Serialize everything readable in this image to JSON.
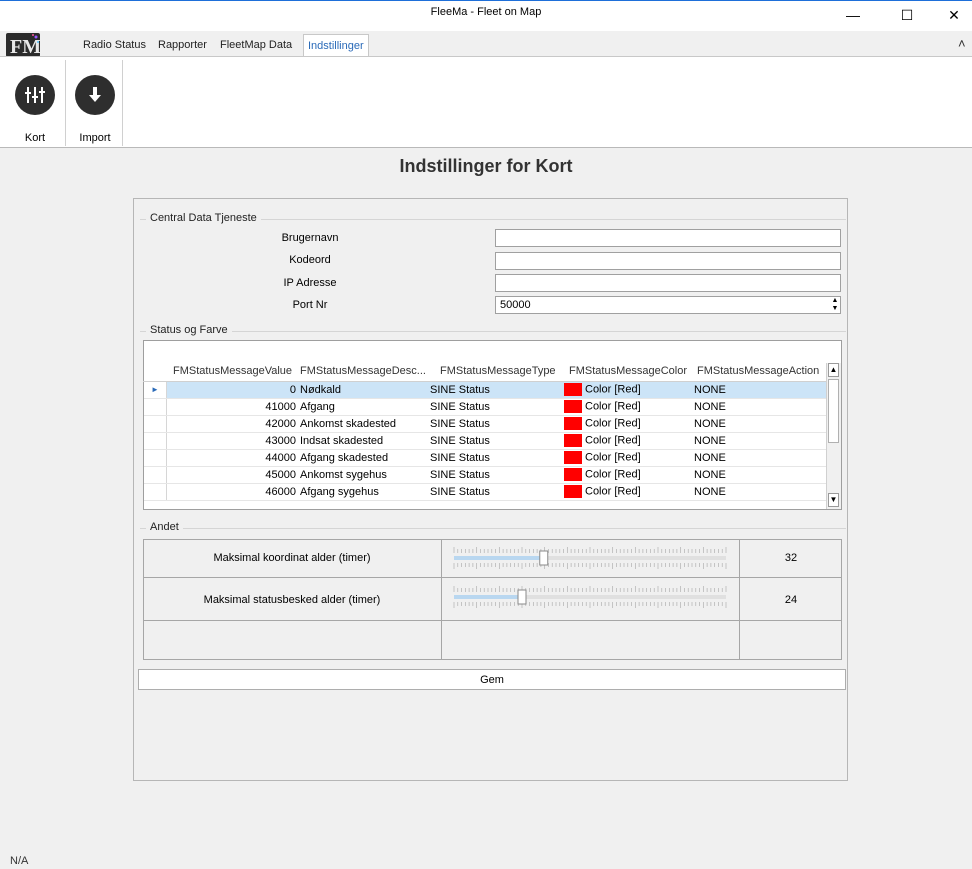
{
  "window": {
    "title": "FleeMa - Fleet on Map",
    "minimize": "—",
    "maximize": "☐",
    "close": "✕"
  },
  "logo_text": "FM",
  "ribbon": {
    "tabs": [
      "Radio Status",
      "Rapporter",
      "FleetMap Data",
      "Indstillinger"
    ],
    "active_tab": "Indstillinger",
    "collapse_glyph": "˄",
    "buttons": [
      {
        "label": "Kort",
        "icon": "sliders-icon"
      },
      {
        "label": "Import",
        "icon": "download-arrow-icon"
      }
    ]
  },
  "page_title": "Indstillinger for Kort",
  "central": {
    "group_label": "Central Data Tjeneste",
    "fields": [
      {
        "label": "Brugernavn",
        "value": ""
      },
      {
        "label": "Kodeord",
        "value": ""
      },
      {
        "label": "IP Adresse",
        "value": ""
      },
      {
        "label": "Port Nr",
        "value": "50000"
      }
    ]
  },
  "status": {
    "group_label": "Status og Farve",
    "columns": [
      "FMStatusMessageValue",
      "FMStatusMessageDesc...",
      "FMStatusMessageType",
      "FMStatusMessageColor",
      "FMStatusMessageAction"
    ],
    "rows": [
      {
        "value": "0",
        "desc": "Nødkald",
        "type": "SINE Status",
        "color_name": "Color [Red]",
        "color": "#ff0000",
        "action": "NONE"
      },
      {
        "value": "41000",
        "desc": "Afgang",
        "type": "SINE Status",
        "color_name": "Color [Red]",
        "color": "#ff0000",
        "action": "NONE"
      },
      {
        "value": "42000",
        "desc": "Ankomst skadested",
        "type": "SINE Status",
        "color_name": "Color [Red]",
        "color": "#ff0000",
        "action": "NONE"
      },
      {
        "value": "43000",
        "desc": "Indsat skadested",
        "type": "SINE Status",
        "color_name": "Color [Red]",
        "color": "#ff0000",
        "action": "NONE"
      },
      {
        "value": "44000",
        "desc": "Afgang skadested",
        "type": "SINE Status",
        "color_name": "Color [Red]",
        "color": "#ff0000",
        "action": "NONE"
      },
      {
        "value": "45000",
        "desc": "Ankomst sygehus",
        "type": "SINE Status",
        "color_name": "Color [Red]",
        "color": "#ff0000",
        "action": "NONE"
      },
      {
        "value": "46000",
        "desc": "Afgang sygehus",
        "type": "SINE Status",
        "color_name": "Color [Red]",
        "color": "#ff0000",
        "action": "NONE"
      }
    ],
    "selected_row": 0
  },
  "andet": {
    "group_label": "Andet",
    "sliders": [
      {
        "label": "Maksimal koordinat alder (timer)",
        "value": "32",
        "fraction": 0.33
      },
      {
        "label": "Maksimal statusbesked alder (timer)",
        "value": "24",
        "fraction": 0.25
      }
    ]
  },
  "save_label": "Gem",
  "status_bar": "N/A",
  "colors": {
    "accent": "#2a6ab8",
    "selected_row": "#cce4f7",
    "slider_fill": "#b9d7f0"
  }
}
